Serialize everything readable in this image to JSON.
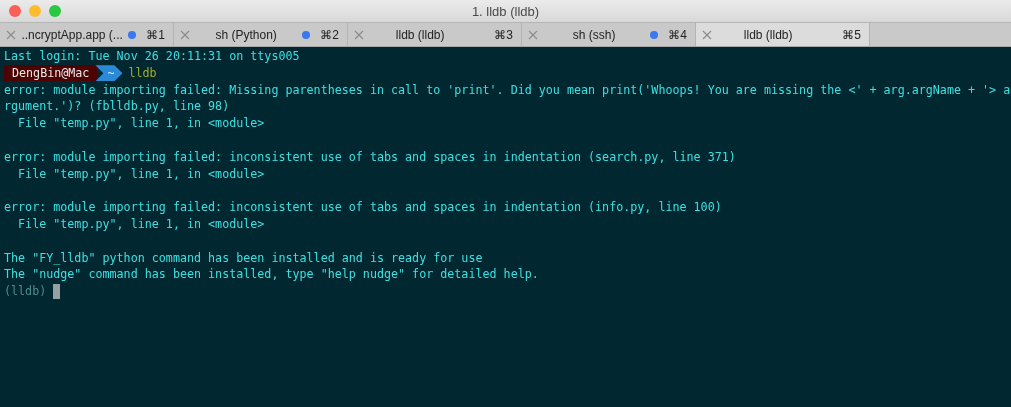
{
  "window": {
    "title": "1. lldb (lldb)"
  },
  "tabs": [
    {
      "label": "..ncryptApp.app (...",
      "shortcut": "⌘1",
      "activity": true,
      "selected": false
    },
    {
      "label": "sh (Python)",
      "shortcut": "⌘2",
      "activity": true,
      "selected": false
    },
    {
      "label": "lldb (lldb)",
      "shortcut": "⌘3",
      "activity": false,
      "selected": false
    },
    {
      "label": "sh (ssh)",
      "shortcut": "⌘4",
      "activity": true,
      "selected": false
    },
    {
      "label": "lldb (lldb)",
      "shortcut": "⌘5",
      "activity": false,
      "selected": true
    }
  ],
  "terminal": {
    "lines": [
      {
        "kind": "output",
        "text": "Last login: Tue Nov 26 20:11:31 on ttys005"
      },
      {
        "kind": "prompt",
        "user": "DengBin@Mac",
        "path": "~",
        "command": "lldb"
      },
      {
        "kind": "output",
        "text": "error: module importing failed: Missing parentheses in call to 'print'. Did you mean print('Whoops! You are missing the <' + arg.argName + '> a"
      },
      {
        "kind": "output",
        "text": "rgument.')? (fblldb.py, line 98)"
      },
      {
        "kind": "output",
        "text": "  File \"temp.py\", line 1, in <module>"
      },
      {
        "kind": "blank"
      },
      {
        "kind": "output",
        "text": "error: module importing failed: inconsistent use of tabs and spaces in indentation (search.py, line 371)"
      },
      {
        "kind": "output",
        "text": "  File \"temp.py\", line 1, in <module>"
      },
      {
        "kind": "blank"
      },
      {
        "kind": "output",
        "text": "error: module importing failed: inconsistent use of tabs and spaces in indentation (info.py, line 100)"
      },
      {
        "kind": "output",
        "text": "  File \"temp.py\", line 1, in <module>"
      },
      {
        "kind": "blank"
      },
      {
        "kind": "output",
        "text": "The \"FY_lldb\" python command has been installed and is ready for use"
      },
      {
        "kind": "output",
        "text": "The \"nudge\" command has been installed, type \"help nudge\" for detailed help."
      },
      {
        "kind": "lldb",
        "text": "(lldb)"
      }
    ]
  }
}
